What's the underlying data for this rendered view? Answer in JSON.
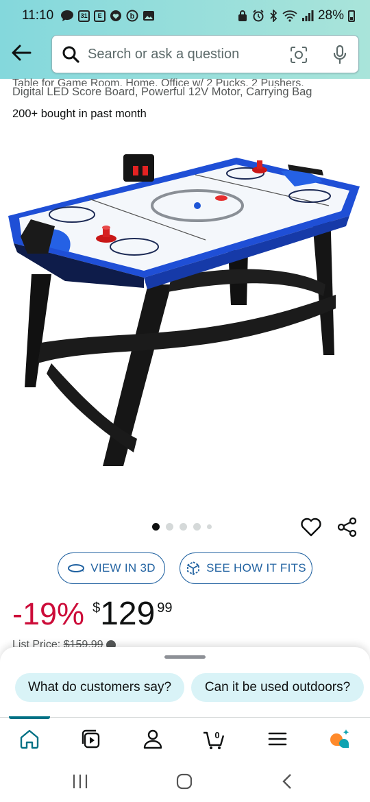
{
  "status_bar": {
    "time": "11:10",
    "calendar_day": "31",
    "e_icon_letter": "E",
    "battery": "28%"
  },
  "search": {
    "placeholder": "Search or ask a question"
  },
  "product": {
    "title_fragment": "Table for Game Room, Home, Office w/ 2 Pucks, 2 Pushers,",
    "title_line": "Digital LED Score Board, Powerful 12V Motor, Carrying Bag",
    "bought": "200+ bought in past month",
    "image_dots": 5,
    "active_dot": 0
  },
  "actions": {
    "view3d_label": "VIEW IN 3D",
    "see_fit_label": "SEE HOW IT FITS"
  },
  "price": {
    "discount": "-19%",
    "currency": "$",
    "dollars": "129",
    "cents": "99",
    "list_price_label": "List Price:",
    "list_price": "$159.99"
  },
  "bottom_sheet": {
    "chips": [
      "What do customers say?",
      "Can it be used outdoors?"
    ]
  },
  "bottom_nav": {
    "cart_count": "0",
    "items": [
      "home-icon",
      "video-icon",
      "account-icon",
      "cart-icon",
      "menu-icon",
      "rufus-icon"
    ],
    "active_index": 0
  },
  "colors": {
    "header_gradient_start": "#84d8dc",
    "header_gradient_end": "#a9e4da",
    "link_blue": "#2162a1",
    "discount_red": "#cc0c39",
    "chip_bg": "#d9f3f7",
    "accent_teal": "#007185"
  }
}
